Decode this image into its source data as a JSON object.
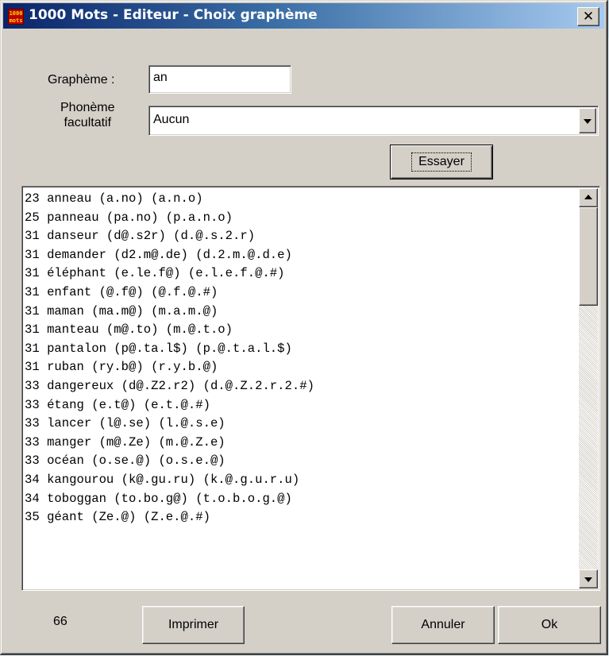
{
  "window": {
    "title": "1000 Mots - Editeur - Choix graphème",
    "icon_text": "1000 mots",
    "close_glyph": "✕"
  },
  "form": {
    "grapheme_label": "Graphème :",
    "grapheme_value": "an",
    "phoneme_label_line1": "Phonème",
    "phoneme_label_line2": "facultatif",
    "phoneme_selected": "Aucun",
    "try_button": "Essayer"
  },
  "list": {
    "items": [
      "23 anneau (a.no) (a.n.o)",
      "25 panneau (pa.no) (p.a.n.o)",
      "31 danseur (d@.s2r) (d.@.s.2.r)",
      "31 demander (d2.m@.de) (d.2.m.@.d.e)",
      "31 éléphant (e.le.f@) (e.l.e.f.@.#)",
      "31 enfant (@.f@) (@.f.@.#)",
      "31 maman (ma.m@) (m.a.m.@)",
      "31 manteau (m@.to) (m.@.t.o)",
      "31 pantalon (p@.ta.l$) (p.@.t.a.l.$)",
      "31 ruban (ry.b@) (r.y.b.@)",
      "33 dangereux (d@.Z2.r2) (d.@.Z.2.r.2.#)",
      "33 étang (e.t@) (e.t.@.#)",
      "33 lancer (l@.se) (l.@.s.e)",
      "33 manger (m@.Ze) (m.@.Z.e)",
      "33 océan (o.se.@) (o.s.e.@)",
      "34 kangourou (k@.gu.ru) (k.@.g.u.r.u)",
      "34 toboggan (to.bo.g@) (t.o.b.o.g.@)",
      "35 géant (Ze.@) (Z.e.@.#)"
    ]
  },
  "footer": {
    "count": "66",
    "print_button": "Imprimer",
    "cancel_button": "Annuler",
    "ok_button": "Ok"
  },
  "colors": {
    "titlebar_start": "#0a246a",
    "titlebar_end": "#a6caf0",
    "face": "#d4d0c8"
  }
}
